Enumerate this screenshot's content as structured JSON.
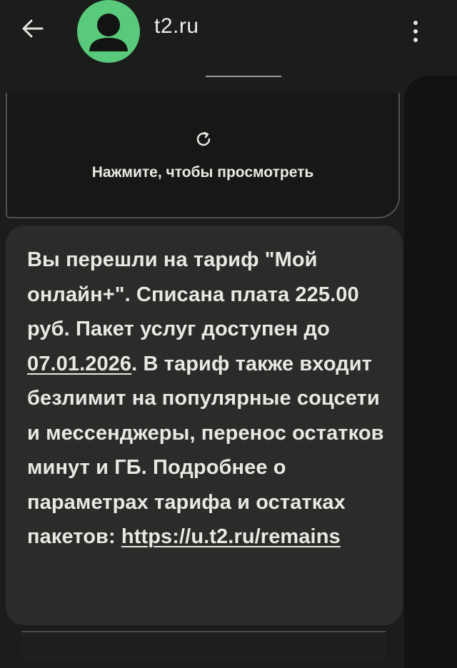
{
  "header": {
    "title": "t2.ru",
    "back_icon": "arrow-left-icon",
    "avatar_icon": "person-avatar-icon",
    "menu_icon": "more-vertical-icon",
    "avatar_color": "#59c97b"
  },
  "media_card": {
    "icon": "reload-icon",
    "label": "Нажмите, чтобы просмотреть"
  },
  "message": {
    "text_before_date": "Вы перешли на тариф \"Мой онлайн+\". Списана плата 225.00 руб. Пакет услуг доступен до ",
    "date": "07.01.2026",
    "text_after_date": ". В тариф также входит безлимит на популярные соцсети и мессенджеры, перенос остатков минут и ГБ. Подробнее о параметрах тарифа и остатках пакетов: ",
    "link": "https://u.t2.ru/remains"
  }
}
